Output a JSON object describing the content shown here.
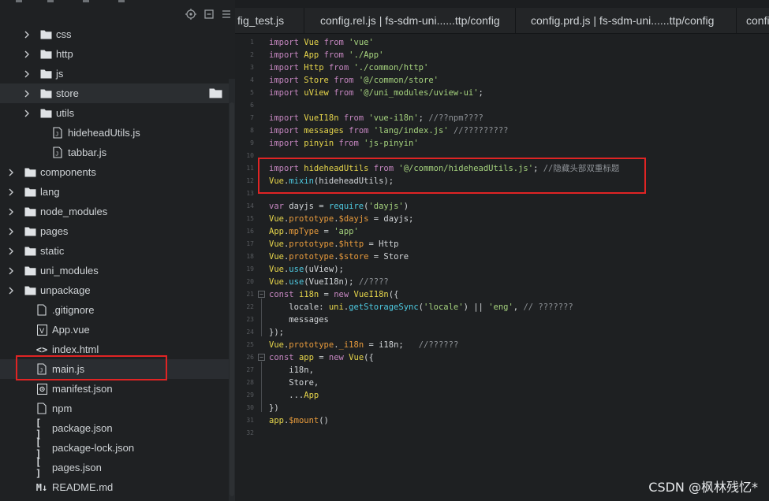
{
  "sidebar": {
    "tree": [
      {
        "label": "css",
        "type": "folder",
        "expanded": false
      },
      {
        "label": "http",
        "type": "folder",
        "expanded": false
      },
      {
        "label": "js",
        "type": "folder",
        "expanded": false
      },
      {
        "label": "store",
        "type": "folder",
        "expanded": false
      },
      {
        "label": "utils",
        "type": "folder",
        "expanded": false
      },
      {
        "label": "hideheadUtils.js",
        "type": "js-file"
      },
      {
        "label": "tabbar.js",
        "type": "js-file"
      },
      {
        "label": "components",
        "type": "folder",
        "expanded": false
      },
      {
        "label": "lang",
        "type": "folder",
        "expanded": false
      },
      {
        "label": "node_modules",
        "type": "folder",
        "expanded": false
      },
      {
        "label": "pages",
        "type": "folder",
        "expanded": false
      },
      {
        "label": "static",
        "type": "folder",
        "expanded": false
      },
      {
        "label": "uni_modules",
        "type": "folder",
        "expanded": false
      },
      {
        "label": "unpackage",
        "type": "folder",
        "expanded": false
      },
      {
        "label": ".gitignore",
        "type": "file"
      },
      {
        "label": "App.vue",
        "type": "vue-file"
      },
      {
        "label": "index.html",
        "type": "html-file"
      },
      {
        "label": "main.js",
        "type": "js-file"
      },
      {
        "label": "manifest.json",
        "type": "manifest-file"
      },
      {
        "label": "npm",
        "type": "file"
      },
      {
        "label": "package.json",
        "type": "json-file"
      },
      {
        "label": "package-lock.json",
        "type": "json-file"
      },
      {
        "label": "pages.json",
        "type": "json-file"
      },
      {
        "label": "README.md",
        "type": "md-file"
      }
    ],
    "md_badge": "M↓"
  },
  "tabs": [
    {
      "label": "fig_test.js"
    },
    {
      "label": "config.rel.js | fs-sdm-uni......ttp/config"
    },
    {
      "label": "config.prd.js | fs-sdm-uni......ttp/config"
    },
    {
      "label": "confi"
    }
  ],
  "editor": {
    "line_numbers": [
      "1",
      "2",
      "3",
      "4",
      "5",
      "6",
      "7",
      "8",
      "9",
      "10",
      "11",
      "12",
      "13",
      "14",
      "15",
      "16",
      "17",
      "18",
      "19",
      "20",
      "21",
      "22",
      "23",
      "24",
      "25",
      "26",
      "27",
      "28",
      "29",
      "30",
      "31",
      "32"
    ],
    "fold_markers": [
      "−",
      "−",
      "−"
    ],
    "lines": [
      [
        [
          "kw",
          "import "
        ],
        [
          "id",
          "Vue "
        ],
        [
          "kw",
          "from "
        ],
        [
          "str",
          "'vue'"
        ]
      ],
      [
        [
          "kw",
          "import "
        ],
        [
          "id",
          "App "
        ],
        [
          "kw",
          "from "
        ],
        [
          "str",
          "'./App'"
        ]
      ],
      [
        [
          "kw",
          "import "
        ],
        [
          "id",
          "Http "
        ],
        [
          "kw",
          "from "
        ],
        [
          "str",
          "'./common/http'"
        ]
      ],
      [
        [
          "kw",
          "import "
        ],
        [
          "id",
          "Store "
        ],
        [
          "kw",
          "from "
        ],
        [
          "str",
          "'@/common/store'"
        ]
      ],
      [
        [
          "kw",
          "import "
        ],
        [
          "id",
          "uView "
        ],
        [
          "kw",
          "from "
        ],
        [
          "str",
          "'@/uni_modules/uview-ui'"
        ],
        [
          "pl",
          ";"
        ]
      ],
      [],
      [
        [
          "kw",
          "import "
        ],
        [
          "id",
          "VueI18n "
        ],
        [
          "kw",
          "from "
        ],
        [
          "str",
          "'vue-i18n'"
        ],
        [
          "pl",
          "; "
        ],
        [
          "com",
          "//??npm????"
        ]
      ],
      [
        [
          "kw",
          "import "
        ],
        [
          "id",
          "messages "
        ],
        [
          "kw",
          "from "
        ],
        [
          "str",
          "'lang/index.js'"
        ],
        [
          "pl",
          " "
        ],
        [
          "com",
          "//?????????"
        ]
      ],
      [
        [
          "kw",
          "import "
        ],
        [
          "id",
          "pinyin "
        ],
        [
          "kw",
          "from "
        ],
        [
          "str",
          "'js-pinyin'"
        ]
      ],
      [],
      [
        [
          "kw",
          "import "
        ],
        [
          "id",
          "hideheadUtils "
        ],
        [
          "kw",
          "from "
        ],
        [
          "str",
          "'@/common/hideheadUtils.js'"
        ],
        [
          "pl",
          "; "
        ],
        [
          "com",
          "//隐藏头部双重标题"
        ]
      ],
      [
        [
          "id",
          "Vue"
        ],
        [
          "pl",
          "."
        ],
        [
          "fn",
          "mixin"
        ],
        [
          "pl",
          "(hideheadUtils);"
        ]
      ],
      [],
      [
        [
          "kw",
          "var "
        ],
        [
          "pl",
          "dayjs = "
        ],
        [
          "fn",
          "require"
        ],
        [
          "pl",
          "("
        ],
        [
          "str",
          "'dayjs'"
        ],
        [
          "pl",
          ")"
        ]
      ],
      [
        [
          "id",
          "Vue"
        ],
        [
          "pl",
          "."
        ],
        [
          "pr",
          "prototype"
        ],
        [
          "pl",
          "."
        ],
        [
          "pr",
          "$dayjs"
        ],
        [
          "pl",
          " = dayjs;"
        ]
      ],
      [
        [
          "id",
          "App"
        ],
        [
          "pl",
          "."
        ],
        [
          "pr",
          "mpType"
        ],
        [
          "pl",
          " = "
        ],
        [
          "str",
          "'app'"
        ]
      ],
      [
        [
          "id",
          "Vue"
        ],
        [
          "pl",
          "."
        ],
        [
          "pr",
          "prototype"
        ],
        [
          "pl",
          "."
        ],
        [
          "pr",
          "$http"
        ],
        [
          "pl",
          " = Http"
        ]
      ],
      [
        [
          "id",
          "Vue"
        ],
        [
          "pl",
          "."
        ],
        [
          "pr",
          "prototype"
        ],
        [
          "pl",
          "."
        ],
        [
          "pr",
          "$store"
        ],
        [
          "pl",
          " = Store"
        ]
      ],
      [
        [
          "id",
          "Vue"
        ],
        [
          "pl",
          "."
        ],
        [
          "fn",
          "use"
        ],
        [
          "pl",
          "(uView);"
        ]
      ],
      [
        [
          "id",
          "Vue"
        ],
        [
          "pl",
          "."
        ],
        [
          "fn",
          "use"
        ],
        [
          "pl",
          "(VueI18n); "
        ],
        [
          "com",
          "//????"
        ]
      ],
      [
        [
          "kw",
          "const "
        ],
        [
          "id",
          "i18n"
        ],
        [
          "pl",
          " = "
        ],
        [
          "kw",
          "new "
        ],
        [
          "id",
          "VueI18n"
        ],
        [
          "pl",
          "({"
        ]
      ],
      [
        [
          "pl",
          "    locale: "
        ],
        [
          "id",
          "uni"
        ],
        [
          "pl",
          "."
        ],
        [
          "fn",
          "getStorageSync"
        ],
        [
          "pl",
          "("
        ],
        [
          "str",
          "'locale'"
        ],
        [
          "pl",
          ") || "
        ],
        [
          "str",
          "'eng'"
        ],
        [
          "pl",
          ", "
        ],
        [
          "com",
          "// ???????"
        ]
      ],
      [
        [
          "pl",
          "    messages"
        ]
      ],
      [
        [
          "pl",
          "});"
        ]
      ],
      [
        [
          "id",
          "Vue"
        ],
        [
          "pl",
          "."
        ],
        [
          "pr",
          "prototype"
        ],
        [
          "pl",
          "."
        ],
        [
          "pr",
          "_i18n"
        ],
        [
          "pl",
          " = i18n;   "
        ],
        [
          "com",
          "//??????"
        ]
      ],
      [
        [
          "kw",
          "const "
        ],
        [
          "id",
          "app"
        ],
        [
          "pl",
          " = "
        ],
        [
          "kw",
          "new "
        ],
        [
          "id",
          "Vue"
        ],
        [
          "pl",
          "({"
        ]
      ],
      [
        [
          "pl",
          "    i18n,"
        ]
      ],
      [
        [
          "pl",
          "    Store,"
        ]
      ],
      [
        [
          "pl",
          "    ..."
        ],
        [
          "id",
          "App"
        ]
      ],
      [
        [
          "pl",
          "})"
        ]
      ],
      [
        [
          "id",
          "app"
        ],
        [
          "pl",
          "."
        ],
        [
          "pr",
          "$mount"
        ],
        [
          "pl",
          "()"
        ]
      ],
      []
    ]
  },
  "watermark": "CSDN @枫林残忆*",
  "colors": {
    "sidebar_bg": "#1f2123",
    "editor_bg": "#1e2022",
    "keyword": "#c586c0",
    "identifier": "#e6d54b",
    "string": "#a6d37e",
    "comment": "#8e9297",
    "highlight_box": "#e02424"
  }
}
